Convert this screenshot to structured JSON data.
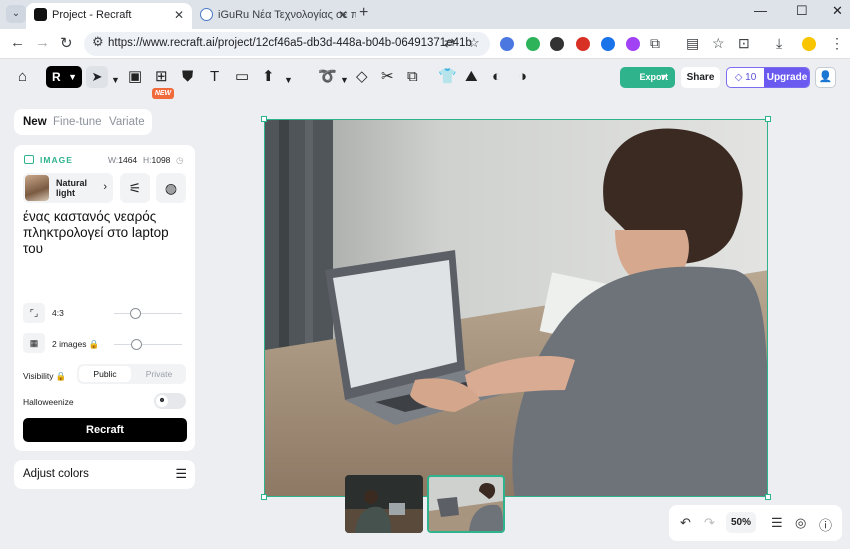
{
  "browser": {
    "tabs": [
      {
        "title": "Project - Recraft",
        "active": true
      },
      {
        "title": "iGuRu Νέα Τεχνολογίας σε πρα…",
        "active": false
      }
    ],
    "url": "https://www.recraft.ai/project/12cf46a5-db3d-448a-b04b-06491371e41b",
    "window_controls": {
      "minimize": "—",
      "maximize": "☐",
      "close": "✕"
    }
  },
  "toolbar": {
    "new_badge": "NEW",
    "export_label": "Export",
    "share_label": "Share",
    "credits": "10",
    "upgrade_label": "Upgrade",
    "text_tool_glyph": "T"
  },
  "sidebar": {
    "mode_tabs": [
      "New",
      "Fine-tune",
      "Variate"
    ],
    "active_mode": "New",
    "section_label": "IMAGE",
    "width_label": "W:",
    "width_value": "1464",
    "height_label": "H:",
    "height_value": "1098",
    "style_name": "Natural light",
    "prompt": "ένας καστανός νεαρός πληκτρολογεί στο laptop του",
    "aspect_ratio": "4:3",
    "image_count": "2 images",
    "visibility_label": "Visibility",
    "visibility_options": [
      "Public",
      "Private"
    ],
    "visibility_selected": "Public",
    "halloweenize_label": "Halloweenize",
    "recraft_button": "Recraft",
    "adjust_colors_label": "Adjust colors"
  },
  "canvas": {
    "selected_thumbnail": 2,
    "thumbnail_count": 2
  },
  "zoom": {
    "level": "50%"
  },
  "colors": {
    "accent_green": "#2fb38d",
    "upgrade_purple": "#6a5af0",
    "new_badge_orange": "#f16a3c"
  }
}
